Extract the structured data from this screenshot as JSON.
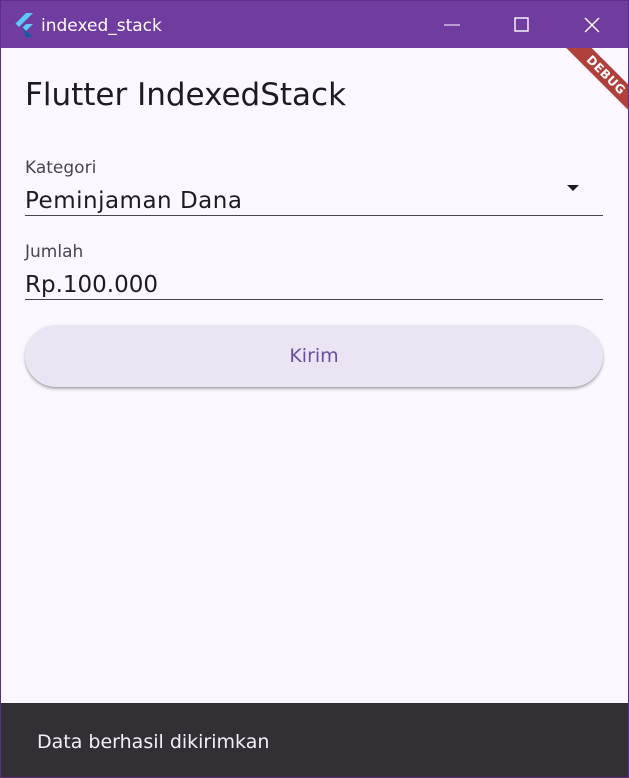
{
  "window": {
    "title": "indexed_stack",
    "icon": "flutter-logo-icon",
    "controls": [
      "minimize-icon",
      "maximize-icon",
      "close-icon"
    ],
    "title_bar_color": "#713c9f"
  },
  "page": {
    "title": "Flutter IndexedStack"
  },
  "form": {
    "kategori": {
      "label": "Kategori",
      "value": "Peminjaman Dana",
      "icon": "dropdown-arrow-icon"
    },
    "jumlah": {
      "label": "Jumlah",
      "value": "Rp.100.000"
    },
    "submit_label": "Kirim"
  },
  "debug_banner": {
    "label": "DEBUG",
    "color": "#b0403c"
  },
  "snackbar": {
    "message": "Data berhasil dikirimkan"
  },
  "colors": {
    "background": "#fdf7ff",
    "button_background": "#ebe5f3",
    "button_text": "#6b4ea3",
    "snackbar_background": "#322f35"
  }
}
